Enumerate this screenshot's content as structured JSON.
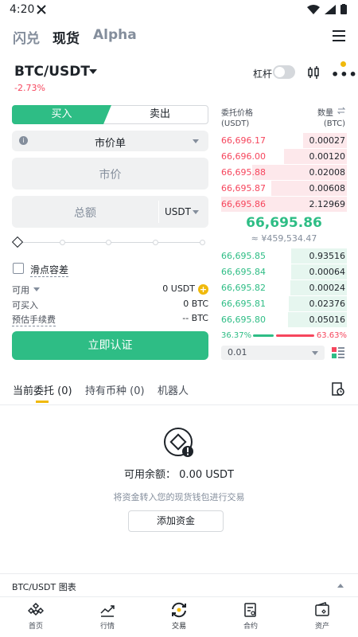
{
  "status": {
    "time": "4:20"
  },
  "topnav": {
    "tabs": [
      {
        "label": "闪兑"
      },
      {
        "label": "现货"
      },
      {
        "label": "Alpha"
      }
    ],
    "active_index": 1
  },
  "header": {
    "pair": "BTC/USDT",
    "change": "-2.73%",
    "leverage_label": "杠杆",
    "leverage_on": false
  },
  "trade": {
    "buy_label": "买入",
    "sell_label": "卖出",
    "order_type": "市价单",
    "price_placeholder": "市价",
    "total_placeholder": "总额",
    "total_unit": "USDT",
    "slippage_label": "滑点容差",
    "available_label": "可用",
    "available_value": "0 USDT",
    "can_buy_label": "可买入",
    "can_buy_value": "0 BTC",
    "fee_label": "预估手续费",
    "fee_value": "-- BTC",
    "submit_label": "立即认证"
  },
  "orderbook": {
    "price_header": "委托价格",
    "price_unit": "(USDT)",
    "qty_header": "数量",
    "qty_unit": "(BTC)",
    "asks": [
      {
        "price": "66,696.17",
        "qty": "0.00027",
        "depth": 0.35
      },
      {
        "price": "66,696.00",
        "qty": "0.00120",
        "depth": 0.5
      },
      {
        "price": "66,695.88",
        "qty": "0.02008",
        "depth": 0.75
      },
      {
        "price": "66,695.87",
        "qty": "0.00608",
        "depth": 0.6
      },
      {
        "price": "66,695.86",
        "qty": "2.12969",
        "depth": 1.0
      }
    ],
    "mid_price": "66,695.86",
    "mid_fiat": "≈ ¥459,534.47",
    "bids": [
      {
        "price": "66,695.85",
        "qty": "0.93516",
        "depth": 0.44
      },
      {
        "price": "66,695.84",
        "qty": "0.00064",
        "depth": 0.44
      },
      {
        "price": "66,695.82",
        "qty": "0.00024",
        "depth": 0.45
      },
      {
        "price": "66,695.81",
        "qty": "0.02376",
        "depth": 0.46
      },
      {
        "price": "66,695.80",
        "qty": "0.05016",
        "depth": 0.47
      }
    ],
    "buy_ratio": "36.37%",
    "sell_ratio": "63.63%",
    "precision": "0.01"
  },
  "orders": {
    "tabs": [
      {
        "label": "当前委托 (0)"
      },
      {
        "label": "持有币种 (0)"
      },
      {
        "label": "机器人"
      }
    ],
    "avail_text": "可用余额： 0.00 USDT",
    "hint": "将资金转入您的现货钱包进行交易",
    "add_funds": "添加资金"
  },
  "chart_bar": {
    "label": "BTC/USDT 图表"
  },
  "bottom_nav": [
    {
      "label": "首页"
    },
    {
      "label": "行情"
    },
    {
      "label": "交易"
    },
    {
      "label": "合约"
    },
    {
      "label": "资产"
    }
  ],
  "colors": {
    "green": "#2ebd85",
    "red": "#f6465d",
    "yellow": "#f0b90b"
  }
}
